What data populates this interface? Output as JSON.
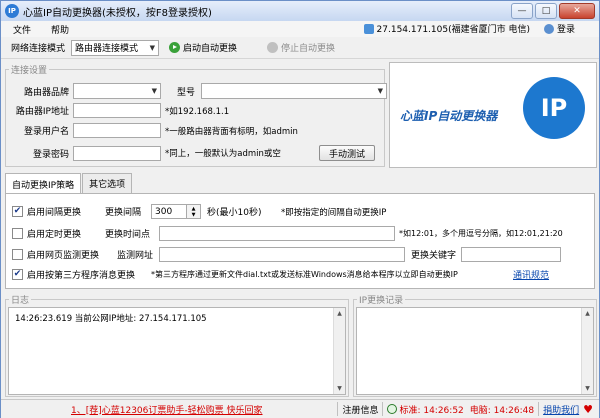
{
  "window": {
    "title": "心蓝IP自动更换器(未授权，按F8登录授权)",
    "app_icon": "IP",
    "min": "—",
    "max": "□",
    "close": "✕"
  },
  "menu": {
    "file": "文件",
    "help": "帮助"
  },
  "ipinfo": {
    "ip": "27.154.171.105(福建省厦门市 电信)",
    "login": "登录"
  },
  "toolbar": {
    "mode_label": "网络连接模式",
    "mode_value": "路由器连接模式",
    "start": "启动自动更换",
    "stop": "停止自动更换"
  },
  "connection": {
    "group_title": "连接设置",
    "brand_label": "路由器品牌",
    "model_label": "型号",
    "ip_label": "路由器IP地址",
    "ip_hint": "*如192.168.1.1",
    "user_label": "登录用户名",
    "user_hint": "*一般路由器背面有标明，如admin",
    "pass_label": "登录密码",
    "pass_hint": "*同上，一般默认为admin或空",
    "test_button": "手动测试"
  },
  "logo": {
    "mark": "IP",
    "text": "心蓝IP自动更换器"
  },
  "tabs": {
    "auto": "自动更换IP策略",
    "other": "其它选项"
  },
  "strategy": {
    "interval": {
      "checked": true,
      "label": "启用间隔更换",
      "sub_label": "更换间隔",
      "value": "300",
      "unit": "秒(最小10秒)",
      "hint": "*即按指定的间隔自动更换IP"
    },
    "timed": {
      "checked": false,
      "label": "启用定时更换",
      "sub_label": "更换时间点",
      "hint": "*如12:01，多个用逗号分隔，如12:01,21:20"
    },
    "web": {
      "checked": false,
      "label": "启用网页监测更换",
      "sub_label": "监测网址",
      "keyword_label": "更换关键字"
    },
    "third": {
      "checked": true,
      "label": "启用按第三方程序消息更换",
      "hint": "*第三方程序通过更新文件dial.txt或发送标准Windows消息给本程序以立即自动更换IP",
      "link": "通讯规范"
    }
  },
  "log": {
    "title": "日志",
    "lines": [
      "14:26:23.619 当前公网IP地址: 27.154.171.105"
    ]
  },
  "ip_history": {
    "title": "IP更换记录"
  },
  "statusbar": {
    "promo": "1、[荐]心蓝12306订票助手-轻松购票 快乐回家",
    "reg_info": "注册信息",
    "standard_time": "标准: 14:26:52",
    "pc_time": "电脑: 14:26:48",
    "donate": "捐助我们"
  }
}
